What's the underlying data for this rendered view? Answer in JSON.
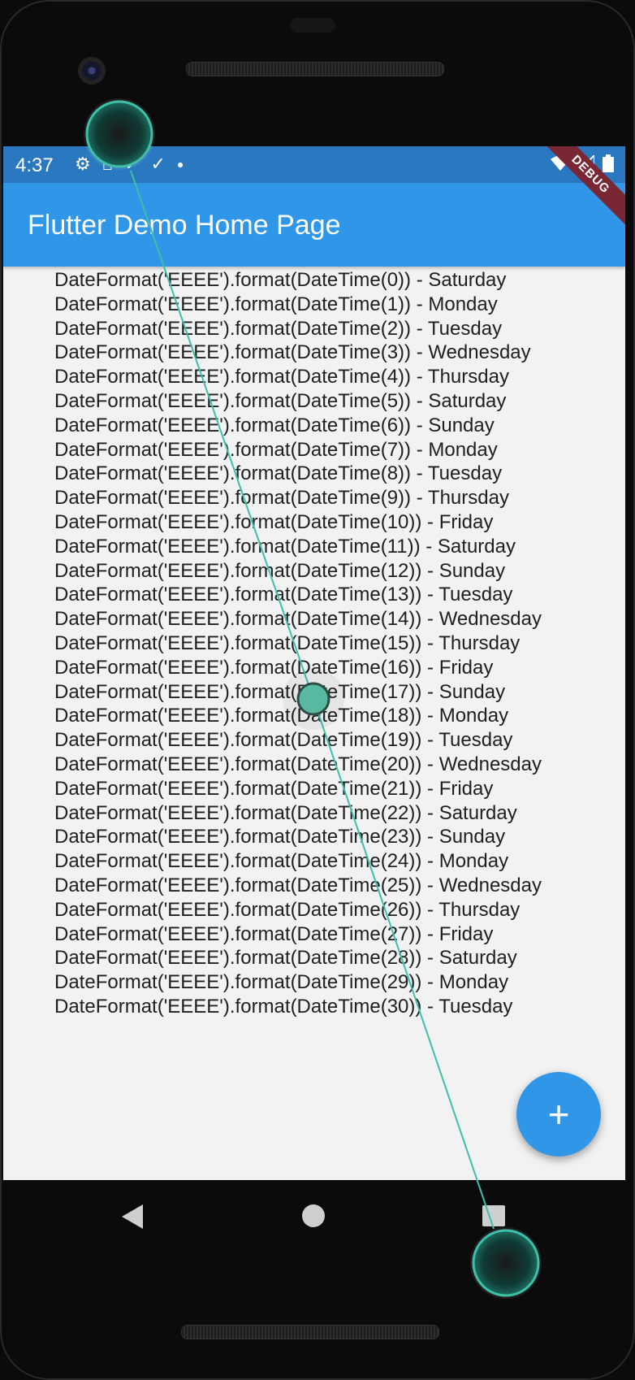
{
  "status_bar": {
    "time": "4:37",
    "left_icons": [
      "gear-icon",
      "home-icon",
      "check-icon",
      "check-icon",
      "dot-icon"
    ],
    "right_icons": [
      "wifi-icon",
      "signal-icon",
      "battery-icon"
    ]
  },
  "app_bar": {
    "title": "Flutter Demo Home Page",
    "debug_banner": "DEBUG"
  },
  "list": {
    "items": [
      "DateFormat('EEEE').format(DateTime(0)) - Saturday",
      "DateFormat('EEEE').format(DateTime(1)) - Monday",
      "DateFormat('EEEE').format(DateTime(2)) - Tuesday",
      "DateFormat('EEEE').format(DateTime(3)) - Wednesday",
      "DateFormat('EEEE').format(DateTime(4)) - Thursday",
      "DateFormat('EEEE').format(DateTime(5)) - Saturday",
      "DateFormat('EEEE').format(DateTime(6)) - Sunday",
      "DateFormat('EEEE').format(DateTime(7)) - Monday",
      "DateFormat('EEEE').format(DateTime(8)) - Tuesday",
      "DateFormat('EEEE').format(DateTime(9)) - Thursday",
      "DateFormat('EEEE').format(DateTime(10)) - Friday",
      "DateFormat('EEEE').format(DateTime(11)) - Saturday",
      "DateFormat('EEEE').format(DateTime(12)) - Sunday",
      "DateFormat('EEEE').format(DateTime(13)) - Tuesday",
      "DateFormat('EEEE').format(DateTime(14)) - Wednesday",
      "DateFormat('EEEE').format(DateTime(15)) - Thursday",
      "DateFormat('EEEE').format(DateTime(16)) - Friday",
      "DateFormat('EEEE').format(DateTime(17)) - Sunday",
      "DateFormat('EEEE').format(DateTime(18)) - Monday",
      "DateFormat('EEEE').format(DateTime(19)) - Tuesday",
      "DateFormat('EEEE').format(DateTime(20)) - Wednesday",
      "DateFormat('EEEE').format(DateTime(21)) - Friday",
      "DateFormat('EEEE').format(DateTime(22)) - Saturday",
      "DateFormat('EEEE').format(DateTime(23)) - Sunday",
      "DateFormat('EEEE').format(DateTime(24)) - Monday",
      "DateFormat('EEEE').format(DateTime(25)) - Wednesday",
      "DateFormat('EEEE').format(DateTime(26)) - Thursday",
      "DateFormat('EEEE').format(DateTime(27)) - Friday",
      "DateFormat('EEEE').format(DateTime(28)) - Saturday",
      "DateFormat('EEEE').format(DateTime(29)) - Monday",
      "DateFormat('EEEE').format(DateTime(30)) - Tuesday"
    ]
  },
  "fab": {
    "icon": "plus-icon",
    "label": "+"
  },
  "nav_bar": {
    "icons": [
      "back-icon",
      "home-icon",
      "recents-icon"
    ]
  },
  "colors": {
    "status_bar": "#2a78c0",
    "app_bar": "#2f96e8",
    "fab": "#2f96e8",
    "background": "#f2f2f2",
    "debug_ribbon": "#7a2735",
    "touch_trail": "#3fbfa8"
  }
}
